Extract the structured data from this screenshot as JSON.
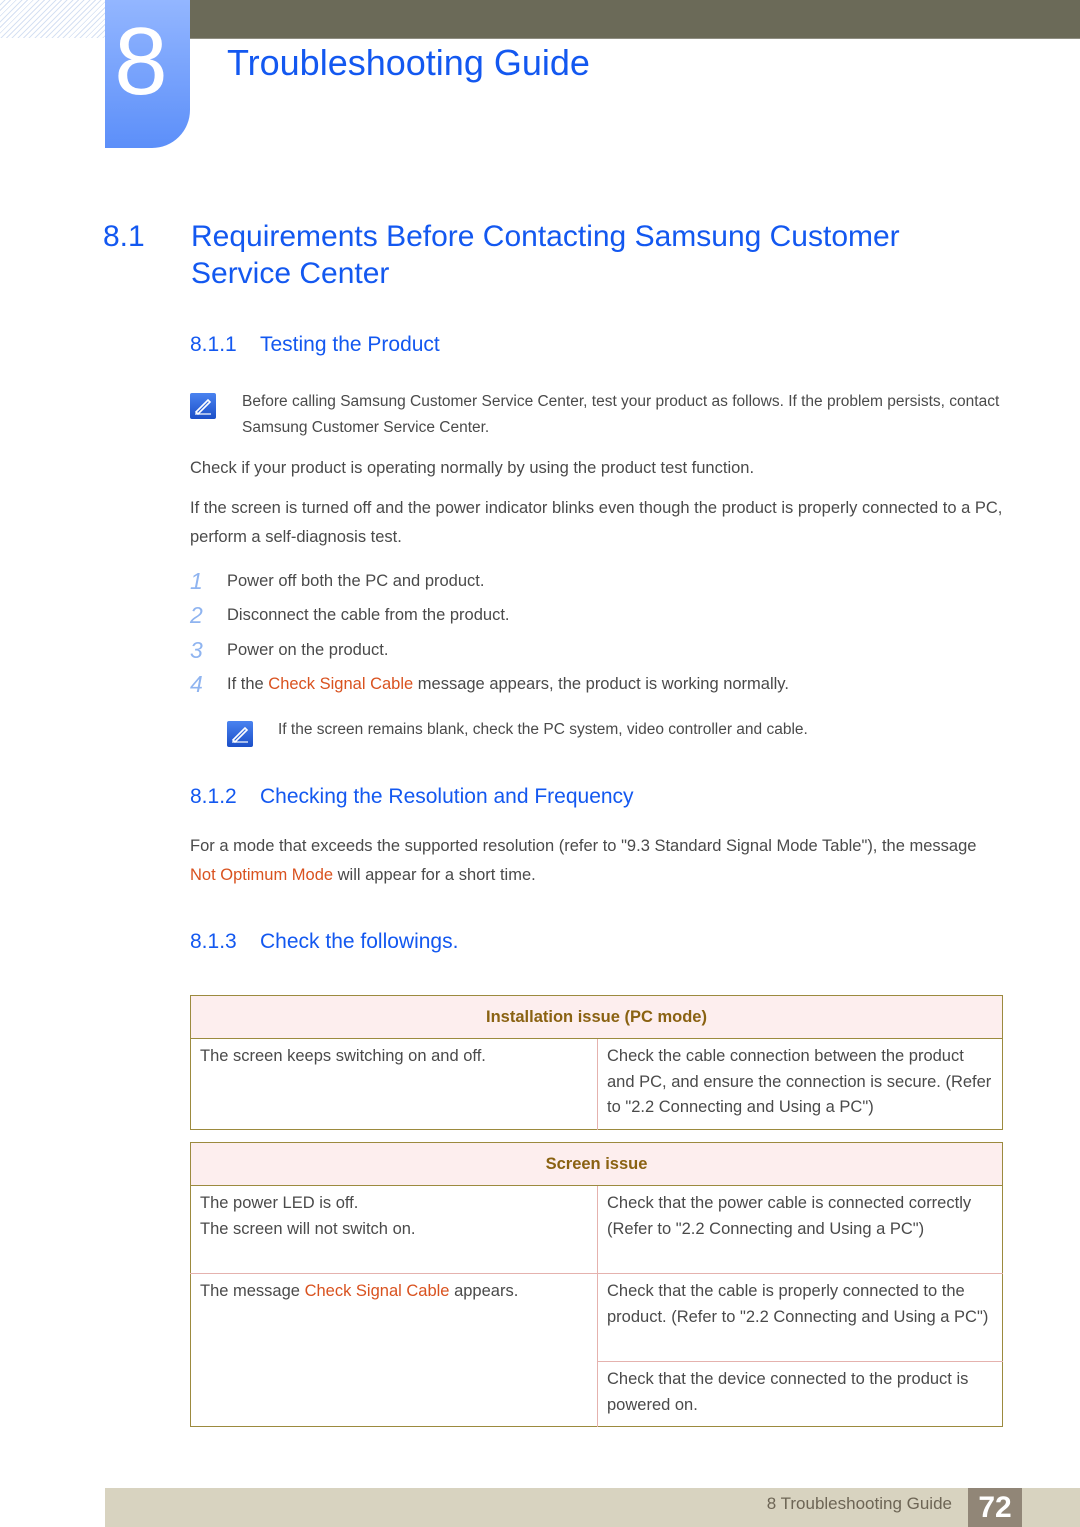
{
  "header": {
    "chapter_number": "8",
    "chapter_title": "Troubleshooting Guide"
  },
  "section": {
    "number": "8.1",
    "title": "Requirements Before Contacting Samsung Customer Service Center"
  },
  "sub1": {
    "number": "8.1.1",
    "title": "Testing the Product",
    "note": "Before calling Samsung Customer Service Center, test your product as follows. If the problem persists, contact Samsung Customer Service Center.",
    "para1": "Check if your product is operating normally by using the product test function.",
    "para2": "If the screen is turned off and the power indicator blinks even though the product is properly connected to a PC, perform a self-diagnosis test.",
    "steps": [
      {
        "n": "1",
        "text": "Power off both the PC and product."
      },
      {
        "n": "2",
        "text": "Disconnect the cable from the product."
      },
      {
        "n": "3",
        "text": "Power on the product."
      },
      {
        "n": "4",
        "pre": "If the ",
        "highlight": "Check Signal Cable",
        "post": " message appears, the product is working normally."
      }
    ],
    "note2": "If the screen remains blank, check the PC system, video controller and cable."
  },
  "sub2": {
    "number": "8.1.2",
    "title": "Checking the Resolution and Frequency",
    "pre": "For a mode that exceeds the supported resolution (refer to \"9.3 Standard Signal Mode Table\"), the message ",
    "highlight": "Not Optimum Mode",
    "post": " will appear for a short time."
  },
  "sub3": {
    "number": "8.1.3",
    "title": "Check the followings."
  },
  "table1": {
    "header": "Installation issue (PC mode)",
    "rows": [
      {
        "problem": "The screen keeps switching on and off.",
        "solution": "Check the cable connection between the product and PC, and ensure the connection is secure. (Refer to \"2.2 Connecting and Using a PC\")"
      }
    ]
  },
  "table2": {
    "header": "Screen issue",
    "row1": {
      "problem_line1": "The power LED is off.",
      "problem_line2": "The screen will not switch on.",
      "solution": "Check that the power cable is connected correctly (Refer to \"2.2 Connecting and Using a PC\")"
    },
    "row2": {
      "problem_pre": "The message ",
      "problem_highlight": "Check Signal Cable",
      "problem_post": " appears.",
      "solution1": "Check that the cable is properly connected to the product. (Refer to \"2.2 Connecting and Using a PC\")",
      "solution2": "Check that the device connected to the product is powered on."
    }
  },
  "footer": {
    "label": "8 Troubleshooting Guide",
    "page": "72"
  },
  "colors": {
    "heading_blue": "#1358f0",
    "highlight_orange": "#d9521f",
    "table_header_text": "#8a6212",
    "table_header_bg": "#fdeeee"
  }
}
